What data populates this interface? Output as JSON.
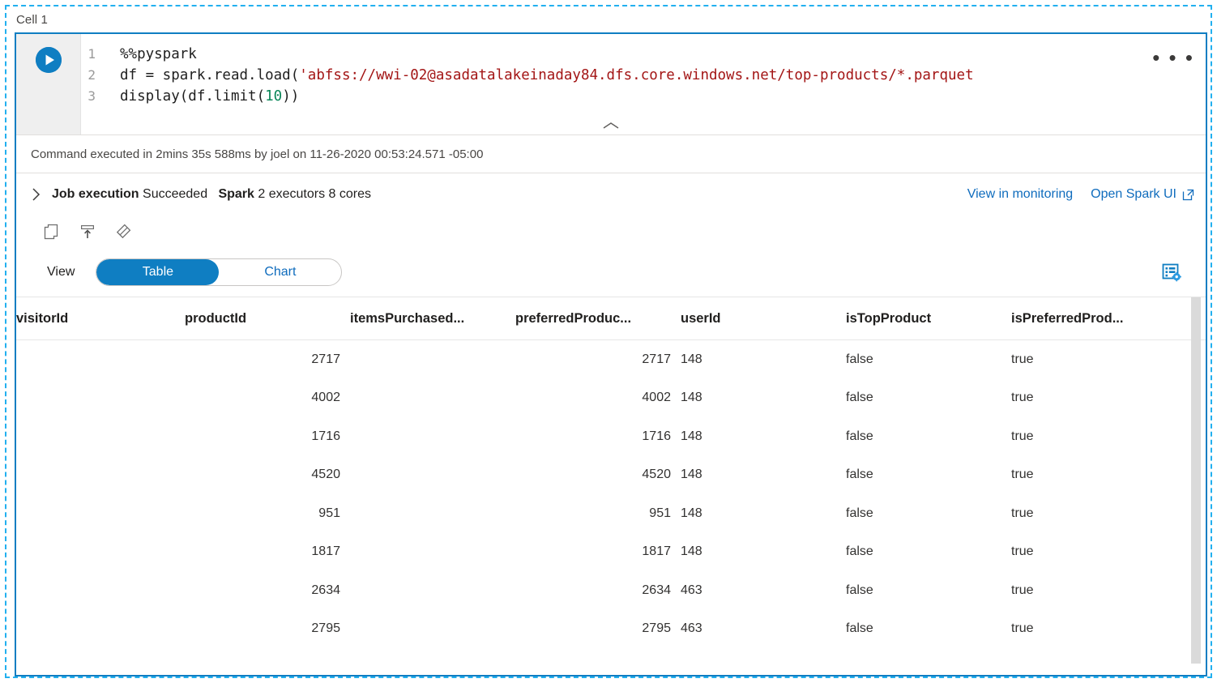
{
  "cell": {
    "label": "Cell 1",
    "run_button": "run-cell",
    "more_menu": "• • •",
    "code": {
      "lines": [
        {
          "n": "1",
          "parts": [
            {
              "t": "%%pyspark",
              "k": "plain"
            }
          ]
        },
        {
          "n": "2",
          "parts": [
            {
              "t": "df = spark.read.load(",
              "k": "plain"
            },
            {
              "t": "'abfss://wwi-02@asadatalakeinaday84.dfs.core.windows.net/top-products/*.parquet",
              "k": "string"
            }
          ]
        },
        {
          "n": "3",
          "parts": [
            {
              "t": "display(df.limit(",
              "k": "plain"
            },
            {
              "t": "10",
              "k": "number"
            },
            {
              "t": "))",
              "k": "plain"
            }
          ]
        }
      ],
      "line_numbers": [
        "1",
        "2",
        "3"
      ],
      "line_1_text": "%%pyspark",
      "line_2_plain": "df = spark.read.load(",
      "line_2_string": "'abfss://wwi-02@asadatalakeinaday84.dfs.core.windows.net/top-products/*.parquet",
      "line_3_a": "display(df.limit(",
      "line_3_num": "10",
      "line_3_b": "))"
    }
  },
  "status": {
    "command_executed": "Command executed in 2mins 35s 588ms by joel on 11-26-2020 00:53:24.571 -05:00"
  },
  "job": {
    "title": "Job execution",
    "state": "Succeeded",
    "engine": "Spark",
    "engine_detail": "2 executors 8 cores",
    "links": [
      {
        "label": "View in monitoring",
        "external": false
      },
      {
        "label": "Open Spark UI",
        "external": true
      }
    ],
    "link_monitoring": "View in monitoring",
    "link_spark_ui": "Open Spark UI"
  },
  "result_toolbar": {
    "icons": [
      {
        "name": "copy-icon",
        "title": "Copy"
      },
      {
        "name": "export-icon",
        "title": "Save output"
      },
      {
        "name": "clear-icon",
        "title": "Clear output"
      }
    ]
  },
  "view": {
    "label": "View",
    "options": [
      "Table",
      "Chart"
    ],
    "selected": "Table",
    "table_option": "Table",
    "chart_option": "Chart",
    "settings_icon": "table-settings-icon"
  },
  "results_table": {
    "columns": [
      "visitorId",
      "productId",
      "itemsPurchased...",
      "preferredProduc...",
      "userId",
      "isTopProduct",
      "isPreferredProd..."
    ],
    "rows": [
      [
        "",
        "2717",
        "",
        "2717",
        "148",
        "false",
        "true"
      ],
      [
        "",
        "4002",
        "",
        "4002",
        "148",
        "false",
        "true"
      ],
      [
        "",
        "1716",
        "",
        "1716",
        "148",
        "false",
        "true"
      ],
      [
        "",
        "4520",
        "",
        "4520",
        "148",
        "false",
        "true"
      ],
      [
        "",
        "951",
        "",
        "951",
        "148",
        "false",
        "true"
      ],
      [
        "",
        "1817",
        "",
        "1817",
        "148",
        "false",
        "true"
      ],
      [
        "",
        "2634",
        "",
        "2634",
        "463",
        "false",
        "true"
      ],
      [
        "",
        "2795",
        "",
        "2795",
        "463",
        "false",
        "true"
      ]
    ]
  },
  "colors": {
    "accent_blue": "#0f7ec2",
    "link_blue": "#0f6cbd",
    "annotation_cyan": "#22b0ef",
    "string_red": "#a31515",
    "number_green": "#098658"
  }
}
